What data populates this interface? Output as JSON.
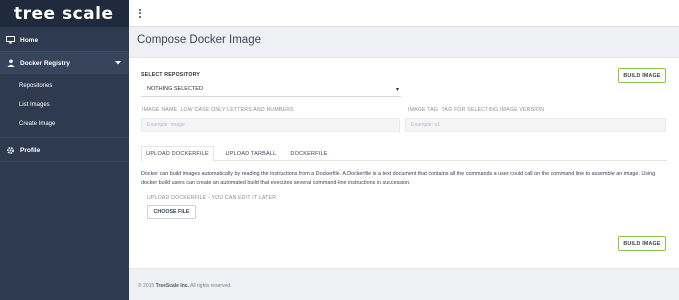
{
  "brand": {
    "logo_text": "tree scale"
  },
  "sidebar": {
    "items": [
      {
        "label": "Home",
        "icon": "monitor-icon"
      },
      {
        "label": "Docker Registry",
        "icon": "person-icon"
      },
      {
        "label": "Profile",
        "icon": "gear-icon"
      }
    ],
    "subitems": [
      {
        "label": "Repositories"
      },
      {
        "label": "List Images"
      },
      {
        "label": "Create Image"
      }
    ]
  },
  "page": {
    "title": "Compose Docker Image"
  },
  "form": {
    "select_repository_label": "SELECT REPOSITORY",
    "select_repository_value": "NOTHING SELECTED",
    "image_name_label": "IMAGE NAME",
    "image_name_hint": "LOW CASE ONLY LETTERS AND NUMBERS",
    "image_name_placeholder": "Example: image",
    "image_tag_label": "IMAGE TAG",
    "image_tag_hint": "TAG FOR SELECTING IMAGE VERSION",
    "image_tag_placeholder": "Example: v1",
    "build_button_label": "BUILD IMAGE"
  },
  "tabs": [
    {
      "label": "UPLOAD DOCKERFILE",
      "active": true
    },
    {
      "label": "UPLOAD TARBALL",
      "active": false
    },
    {
      "label": "DOCKERFILE",
      "active": false
    }
  ],
  "upload": {
    "description": "Docker can build images automatically by reading the instructions from a Dockerfile. A Dockerfile is a text document that contains all the commands a user could call on the command line to assemble an image. Using docker build users can create an automated build that executes several command-line instructions in succession.",
    "label": "UPLOAD DOCKERFILE -  YOU CAN EDIT IT LATER",
    "choose_file_label": "CHOOSE FILE"
  },
  "footer": {
    "prefix": "© 2015",
    "company": "TreeScale Inc.",
    "suffix": " All rights reserved."
  },
  "colors": {
    "sidebar_bg": "#2e3a50",
    "accent_green": "#8bc34a"
  }
}
